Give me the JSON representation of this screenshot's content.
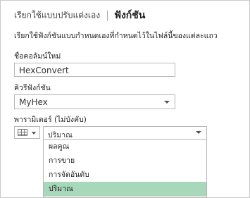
{
  "header": {
    "breadcrumb": "เรียกใช้แบบปรับแต่งเอง",
    "title": "ฟังก์ชัน"
  },
  "description": "เรียกใช้ฟังก์ชันแบบกำหนดเองที่กำหนดไว้ในไฟล์นี้ของแต่ละแถว",
  "new_column": {
    "label": "ชื่อคอลัมน์ใหม่",
    "value": "HexConvert"
  },
  "function_query": {
    "label": "คิวรีฟังก์ชัน",
    "value": "MyHex"
  },
  "parameter": {
    "label": "พารามิเตอร์ (ไม่บังคับ)",
    "type_icon": "column-table-icon",
    "selected": "ปริมาณ",
    "options": [
      "ผลคูณ",
      "การขาย",
      "การจัดอันดับ",
      "ปริมาณ"
    ],
    "selected_index": 3
  },
  "colors": {
    "selected_option_bg": "#a6d8b9",
    "border": "#b7b7b7"
  }
}
